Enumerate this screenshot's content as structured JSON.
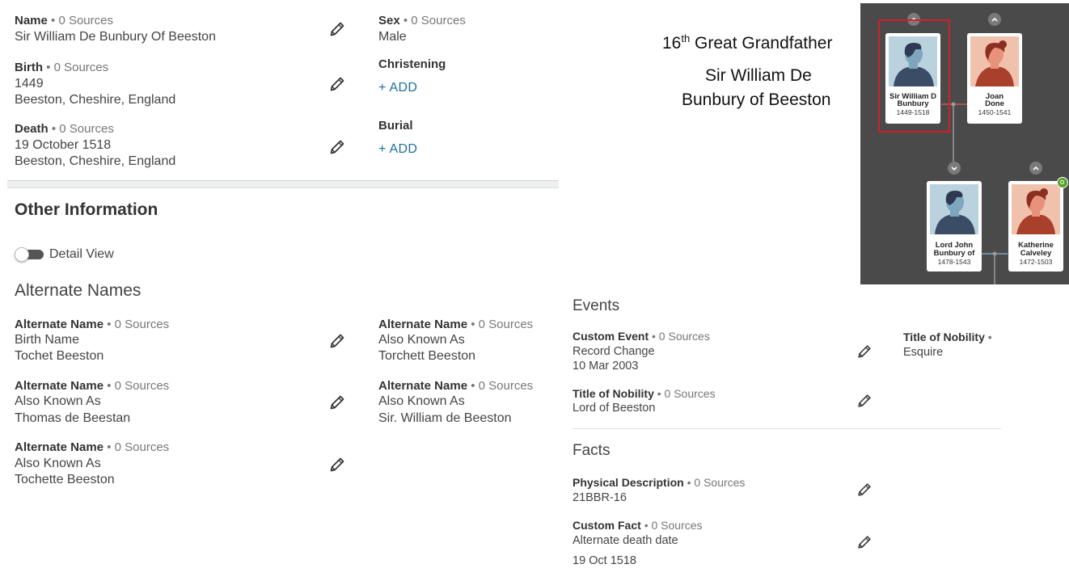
{
  "vitals": {
    "name": {
      "label": "Name",
      "sources": "• 0 Sources",
      "value": "Sir William De Bunbury Of Beeston"
    },
    "sex": {
      "label": "Sex",
      "sources": "• 0 Sources",
      "value": "Male"
    },
    "birth": {
      "label": "Birth",
      "sources": "• 0 Sources",
      "date": "1449",
      "place": "Beeston, Cheshire, England"
    },
    "christening": {
      "label": "Christening",
      "add": "+ ADD"
    },
    "death": {
      "label": "Death",
      "sources": "• 0 Sources",
      "date": "19 October 1518",
      "place": "Beeston, Cheshire, England"
    },
    "burial": {
      "label": "Burial",
      "add": "+ ADD"
    }
  },
  "other_info": {
    "title": "Other Information",
    "detail_view": "Detail View"
  },
  "alternate_names": {
    "title": "Alternate Names",
    "items": [
      {
        "label": "Alternate Name",
        "sources": "• 0 Sources",
        "type": "Birth Name",
        "value": "Tochet Beeston"
      },
      {
        "label": "Alternate Name",
        "sources": "• 0 Sources",
        "type": "Also Known As",
        "value": "Torchett Beeston"
      },
      {
        "label": "Alternate Name",
        "sources": "• 0 Sources",
        "type": "Also Known As",
        "value": "Thomas de Beestan"
      },
      {
        "label": "Alternate Name",
        "sources": "• 0 Sources",
        "type": "Also Known As",
        "value": "Sir. William de Beeston"
      },
      {
        "label": "Alternate Name",
        "sources": "• 0 Sources",
        "type": "Also Known As",
        "value": "Tochette Beeston"
      }
    ]
  },
  "events": {
    "title": "Events",
    "custom_event": {
      "label": "Custom Event",
      "sources": "• 0 Sources",
      "type": "Record Change",
      "date": "10 Mar 2003"
    },
    "title_nobility_right": {
      "label": "Title of Nobility",
      "sources": "•",
      "value": "Esquire"
    },
    "title_nobility": {
      "label": "Title of Nobility",
      "sources": "• 0 Sources",
      "value": "Lord of Beeston"
    }
  },
  "facts": {
    "title": "Facts",
    "physical": {
      "label": "Physical Description",
      "sources": "• 0 Sources",
      "value": "21BBR-16"
    },
    "custom_fact": {
      "label": "Custom Fact",
      "sources": "• 0 Sources",
      "type": "Alternate death date",
      "date": "19 Oct 1518"
    }
  },
  "annotation": {
    "generation_prefix": "16",
    "generation_sup": "th",
    "generation_suffix": " Great Grandfather",
    "name_line1": "Sir William De",
    "name_line2": "Bunbury of Beeston"
  },
  "tree": {
    "persons": [
      {
        "name1": "Sir William D",
        "name2": "Bunbury",
        "years": "1449-1518",
        "gender": "male"
      },
      {
        "name1": "Joan",
        "name2": "Done",
        "years": "1450-1541",
        "gender": "female"
      },
      {
        "name1": "Lord John",
        "name2": "Bunbury of",
        "years": "1478-1543",
        "gender": "male"
      },
      {
        "name1": "Katherine",
        "name2": "Calveley",
        "years": "1472-1503",
        "gender": "female"
      }
    ],
    "colors": {
      "background": "#4a4a4a",
      "highlight": "#d0202a",
      "male_bg": "#b9d2dd",
      "female_bg": "#f0c2ae",
      "hint": "#5aa02c"
    }
  },
  "colors": {
    "link": "#1f6f9f",
    "text": "#333333",
    "muted": "#777777"
  }
}
